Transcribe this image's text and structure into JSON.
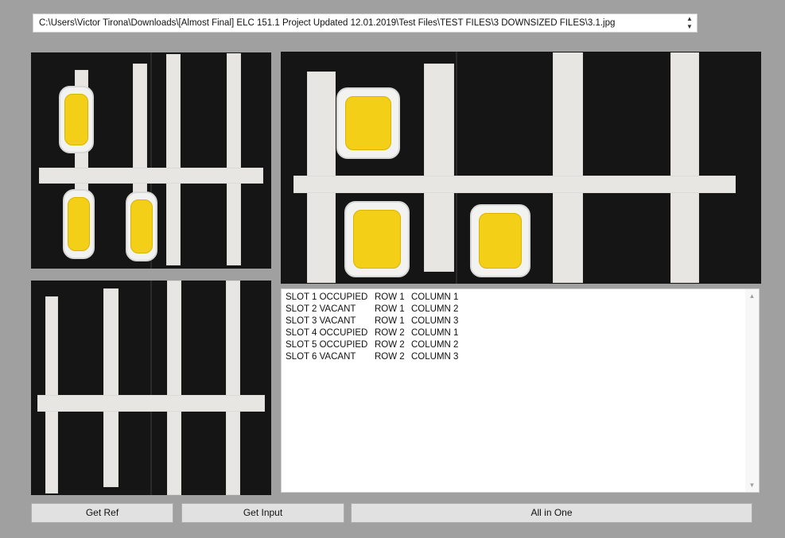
{
  "path_field": {
    "value": "C:\\Users\\Victor Tirona\\Downloads\\[Almost Final] ELC 151.1 Project Updated 12.01.2019\\Test Files\\TEST FILES\\3 DOWNSIZED FILES\\3.1.jpg",
    "spin_up": "▲",
    "spin_down": "▼"
  },
  "images": {
    "input_thumbnail": "input-image",
    "input_large": "input-image-enlarged",
    "reference": "reference-image"
  },
  "output": {
    "lines": [
      {
        "slot": "SLOT 1 OCCUPIED",
        "row": "ROW 1",
        "column": "COLUMN 1"
      },
      {
        "slot": "SLOT 2 VACANT",
        "row": "ROW 1",
        "column": "COLUMN 2"
      },
      {
        "slot": "SLOT 3 VACANT",
        "row": "ROW 1",
        "column": "COLUMN 3"
      },
      {
        "slot": "SLOT 4 OCCUPIED",
        "row": "ROW 2",
        "column": "COLUMN 1"
      },
      {
        "slot": "SLOT 5 OCCUPIED",
        "row": "ROW 2",
        "column": "COLUMN 2"
      },
      {
        "slot": "SLOT 6 VACANT",
        "row": "ROW 2",
        "column": "COLUMN 3"
      }
    ],
    "scroll_up": "▲",
    "scroll_down": "▼"
  },
  "buttons": {
    "get_ref": "Get Ref",
    "get_input": "Get Input",
    "all_in_one": "All in One"
  },
  "colors": {
    "window_bg": "#a0a0a0",
    "board": "#151515",
    "tape": "#e8e6e3",
    "car_yellow": "#f4cf18",
    "button_bg": "#e1e1e1"
  }
}
